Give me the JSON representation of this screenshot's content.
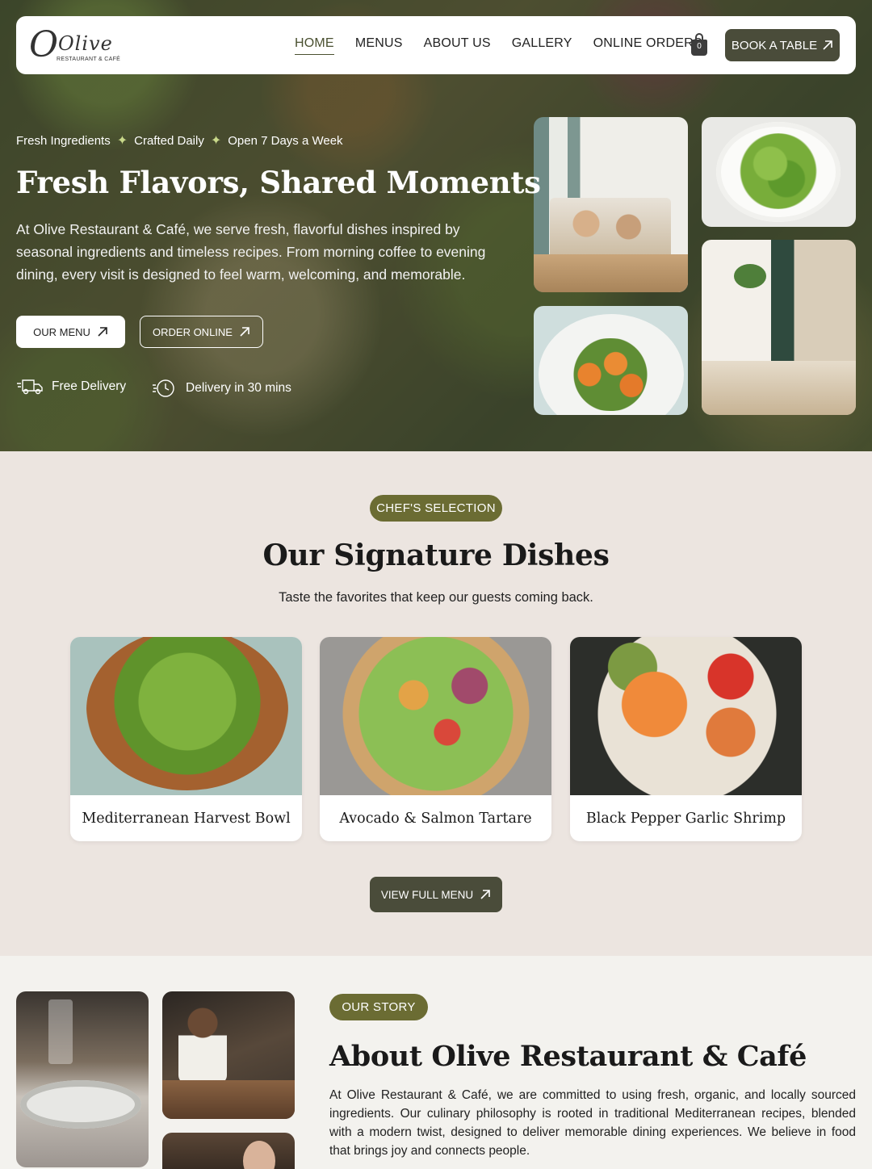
{
  "nav": {
    "logo_main": "Olive",
    "logo_sub": "RESTAURANT & CAFÉ",
    "links": [
      "HOME",
      "MENUS",
      "ABOUT US",
      "GALLERY",
      "ONLINE ORDERS"
    ],
    "active": "HOME",
    "cart_count": "0",
    "book_label": "BOOK A TABLE"
  },
  "hero": {
    "tags": [
      "Fresh Ingredients",
      "Crafted Daily",
      "Open 7 Days a Week"
    ],
    "title": "Fresh Flavors, Shared Moments",
    "description": "At Olive Restaurant & Café, we serve fresh, flavorful dishes inspired by seasonal ingredients and timeless recipes. From morning coffee to evening dining, every visit is designed to feel warm, welcoming, and memorable.",
    "btn_menu": "OUR MENU",
    "btn_order": "ORDER ONLINE",
    "perks": [
      "Free Delivery",
      "Delivery in 30 mins"
    ]
  },
  "signature": {
    "pill": "CHEF'S SELECTION",
    "title": "Our Signature Dishes",
    "subtitle": "Taste the favorites that keep our guests coming back.",
    "dishes": [
      "Mediterranean Harvest Bowl",
      "Avocado & Salmon Tartare",
      "Black Pepper Garlic Shrimp"
    ],
    "view_btn": "VIEW FULL MENU"
  },
  "about": {
    "pill": "OUR STORY",
    "title": "About Olive Restaurant & Café",
    "description": "At Olive Restaurant & Café, we are committed to using fresh, organic, and locally sourced ingredients. Our culinary philosophy is rooted in traditional Mediterranean recipes, blended with a modern twist, designed to deliver memorable dining experiences. We believe in food that brings joy and connects people."
  },
  "colors": {
    "olive_pill": "#6b6c33",
    "dark_button": "#4a4c3a",
    "section_bg": "#ece5e0"
  }
}
